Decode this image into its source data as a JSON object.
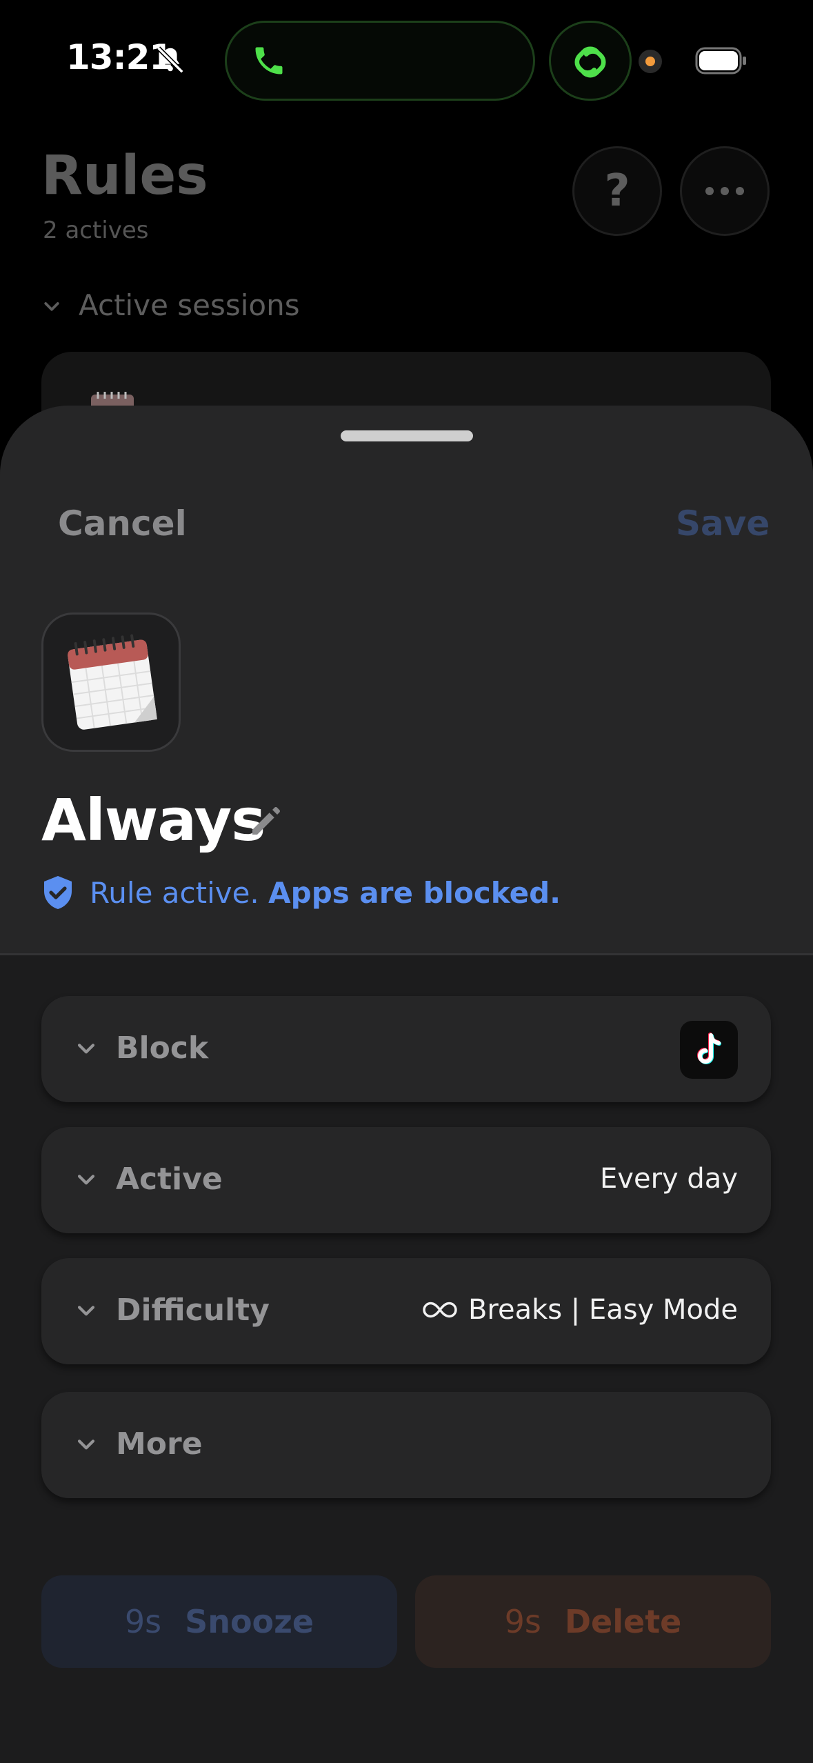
{
  "status_bar": {
    "time": "13:21"
  },
  "background_page": {
    "title": "Rules",
    "subtitle": "2 actives",
    "help_label": "?",
    "section": "Active sessions"
  },
  "sheet": {
    "cancel": "Cancel",
    "save": "Save",
    "rule_name": "Always",
    "status_prefix": "Rule active.",
    "status_emphasis": "Apps are blocked.",
    "rows": [
      {
        "label": "Block",
        "value": ""
      },
      {
        "label": "Active",
        "value": "Every day"
      },
      {
        "label": "Difficulty",
        "value": "Breaks | Easy Mode"
      },
      {
        "label": "More",
        "value": ""
      }
    ],
    "snooze": {
      "timer": "9s",
      "label": "Snooze"
    },
    "delete": {
      "timer": "9s",
      "label": "Delete"
    }
  },
  "colors": {
    "accent_blue": "#5b8ff0",
    "save_dim": "#36476a",
    "delete_dim": "#6d3b28",
    "call_green": "#4ee04a"
  },
  "icons": [
    "bell-slash-icon",
    "phone-icon",
    "link-icon",
    "battery-icon",
    "question-icon",
    "ellipsis-icon",
    "calendar-icon",
    "pencil-icon",
    "shield-check-icon",
    "chevron-down-icon",
    "tiktok-icon",
    "infinity-icon"
  ]
}
